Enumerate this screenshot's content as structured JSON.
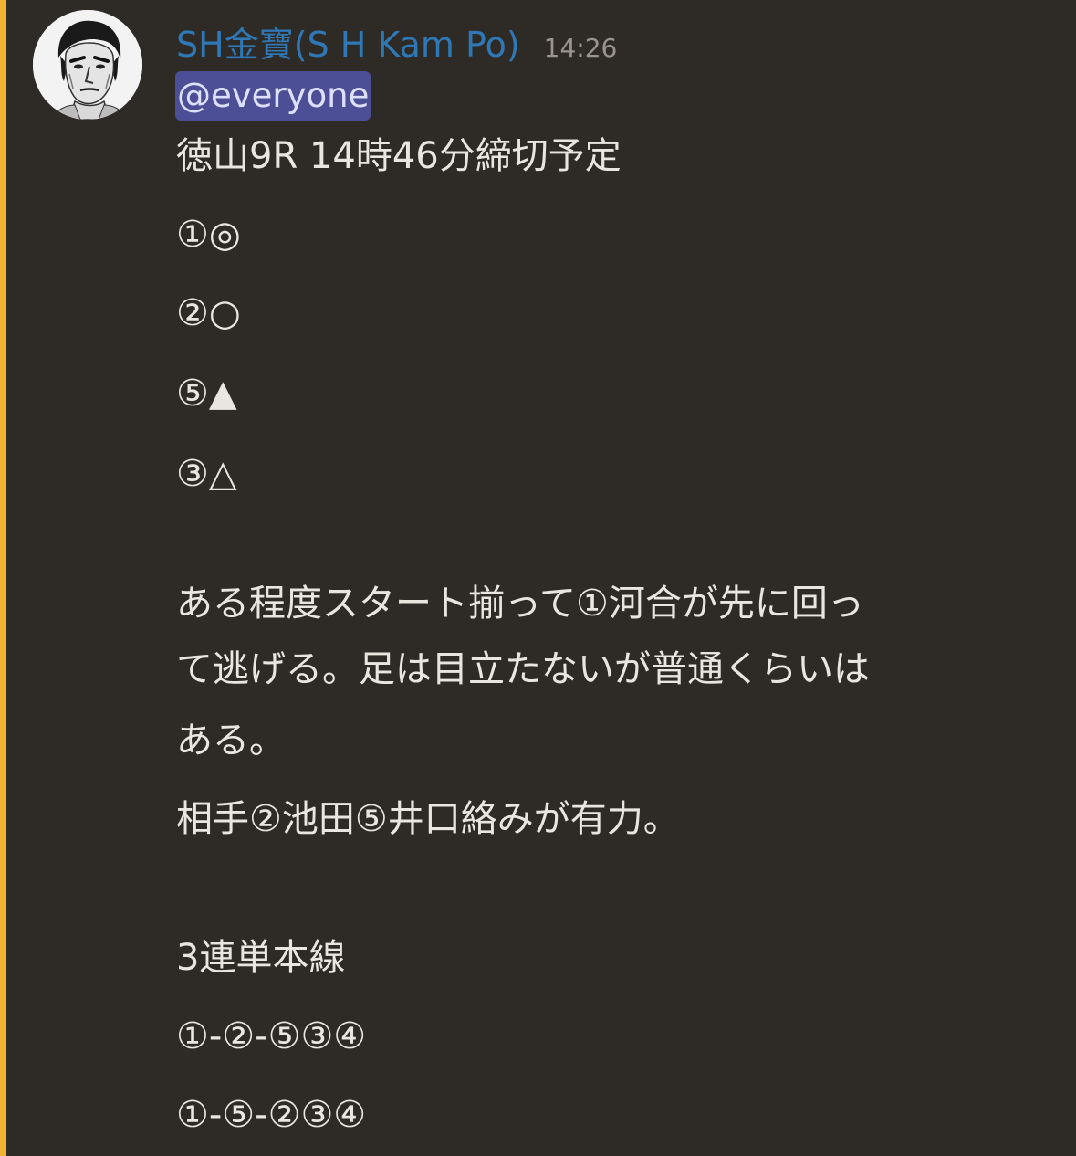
{
  "message": {
    "author": "SH金寶(S H Kam Po)",
    "timestamp": "14:26",
    "mention": "@everyone",
    "lines": [
      "徳山9R 14時46分締切予定",
      "①◎",
      "②○",
      "⑤▲",
      "③△",
      "ある程度スタート揃って①河合が先に回っ",
      "て逃げる。足は目立たないが普通くらいは",
      "ある。",
      "相手②池田⑤井口絡みが有力。",
      "3連単本線",
      "①-②-⑤③④",
      "①-⑤-②③④"
    ]
  },
  "colors": {
    "background": "#2e2b26",
    "mention_bar": "#f0b232",
    "username": "#2f77b5",
    "mention_bg": "#4c4f96",
    "text": "#e9e6df",
    "timestamp": "#9a958c"
  }
}
